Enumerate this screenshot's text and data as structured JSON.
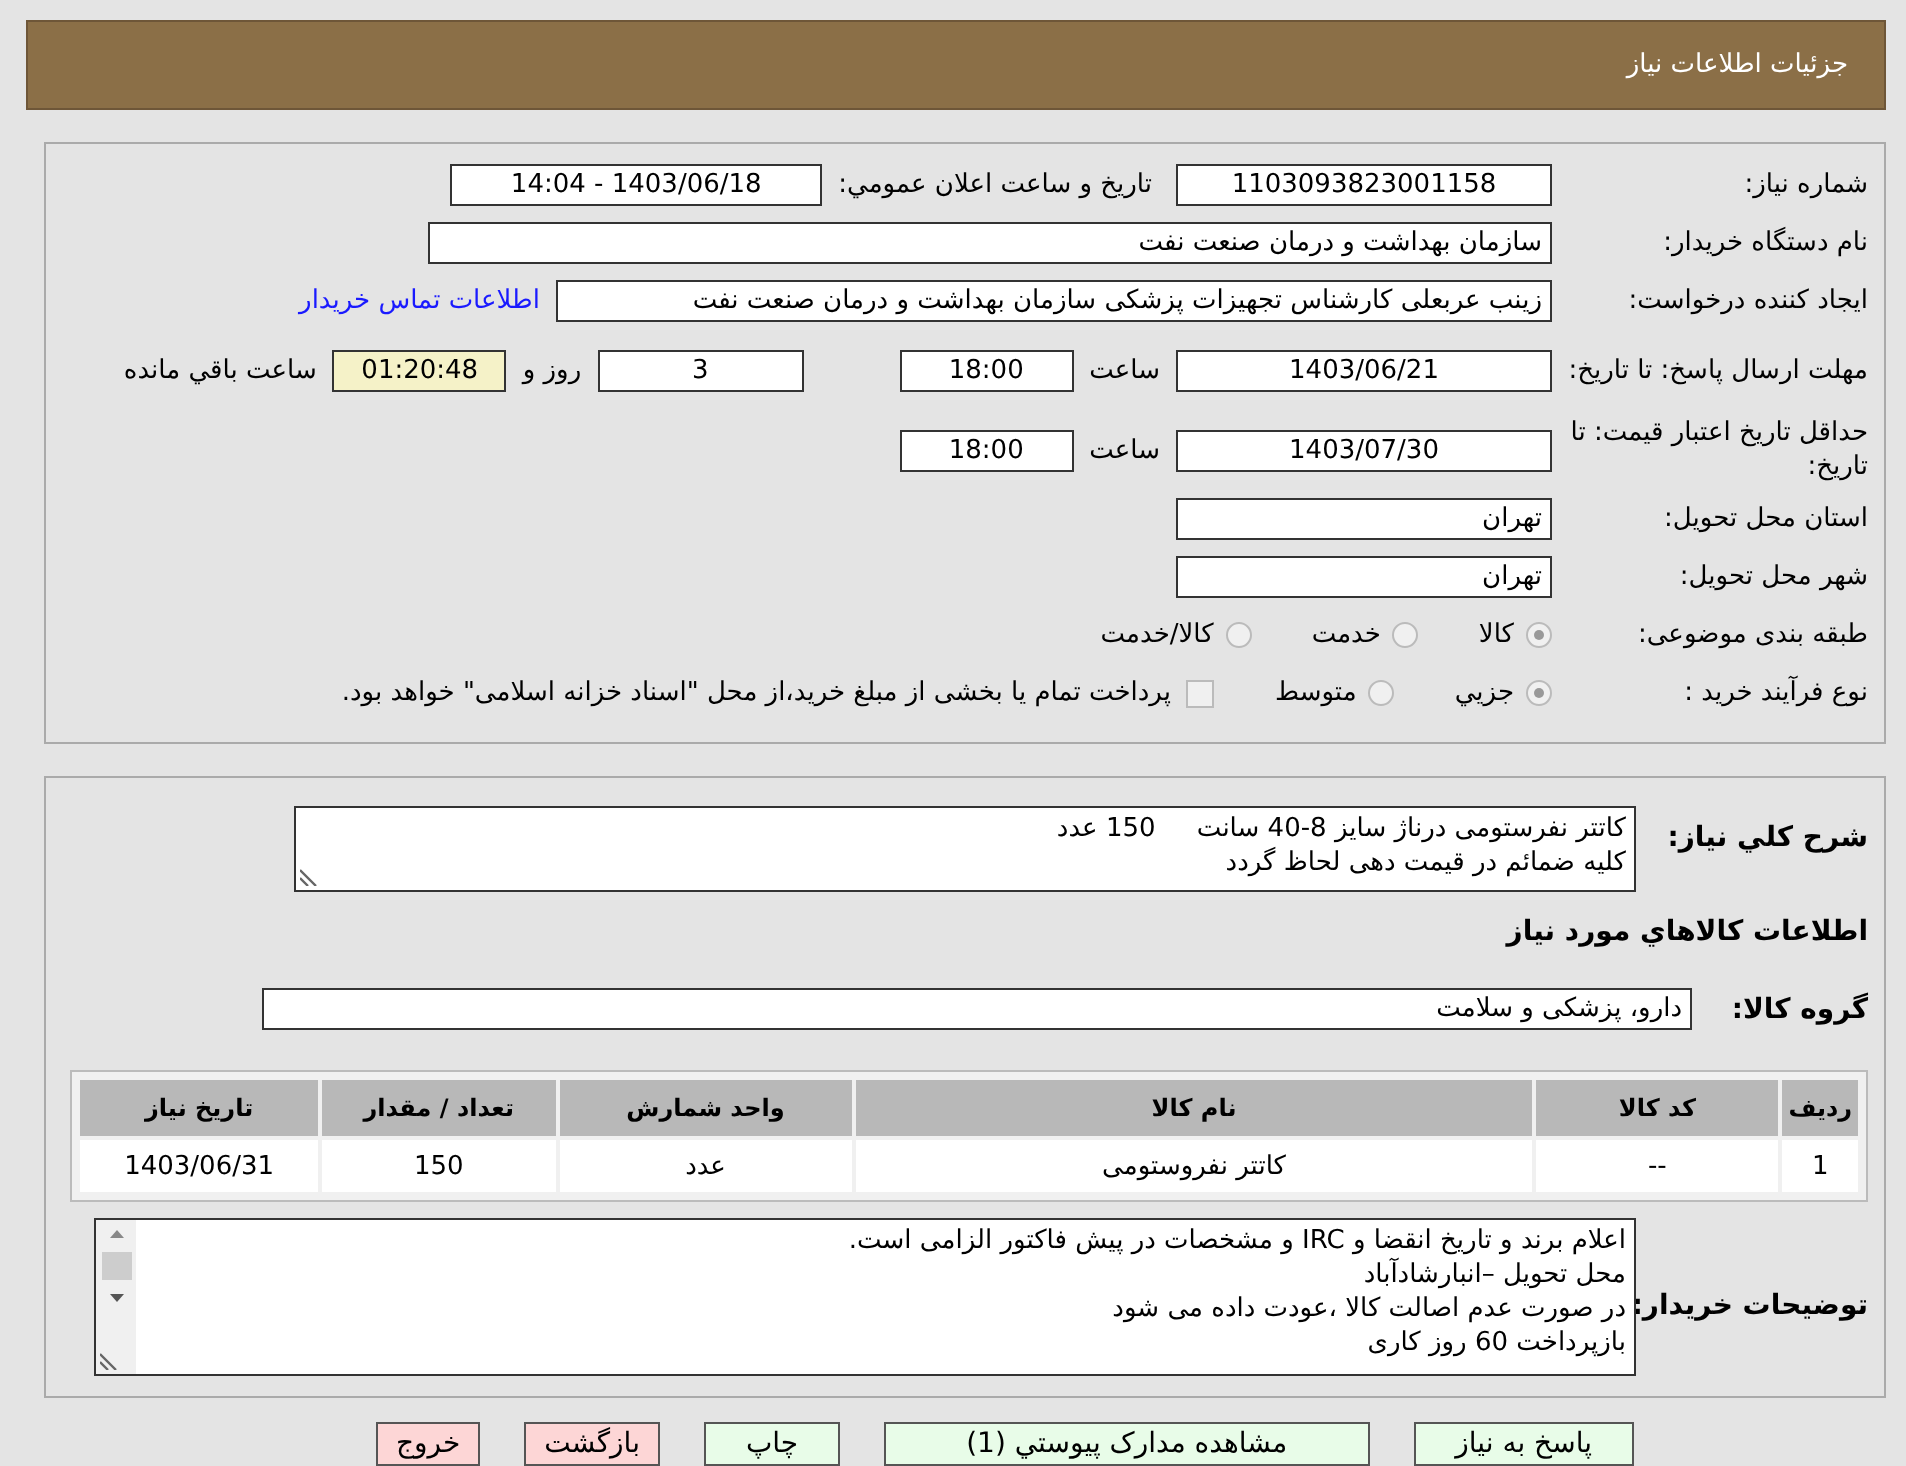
{
  "header": {
    "title": "جزئیات اطلاعات نیاز"
  },
  "details": {
    "need_number": {
      "label": "شماره نیاز:",
      "value": "1103093823001158"
    },
    "announce": {
      "label": "تاریخ و ساعت اعلان عمومي:",
      "value": "1403/06/18 - 14:04"
    },
    "buyer_org": {
      "label": "نام دستگاه خریدار:",
      "value": "سازمان بهداشت و درمان صنعت نفت"
    },
    "requester": {
      "label": "ایجاد کننده درخواست:",
      "value": "زینب عربعلی کارشناس تجهیزات پزشکی سازمان بهداشت و درمان صنعت نفت",
      "link": "اطلاعات تماس خریدار"
    },
    "deadline": {
      "label": "مهلت ارسال پاسخ: تا تاریخ:",
      "date": "1403/06/21",
      "time_label": "ساعت",
      "time": "18:00",
      "days": "3",
      "days_label": "روز و",
      "remaining": "01:20:48",
      "remaining_label": "ساعت باقي مانده"
    },
    "validity": {
      "label": "حداقل تاریخ اعتبار قیمت: تا تاریخ:",
      "date": "1403/07/30",
      "time_label": "ساعت",
      "time": "18:00"
    },
    "province": {
      "label": "استان محل تحویل:",
      "value": "تهران"
    },
    "city": {
      "label": "شهر محل تحویل:",
      "value": "تهران"
    },
    "category": {
      "label": "طبقه بندی موضوعی:",
      "options": [
        {
          "label": "کالا",
          "selected": true
        },
        {
          "label": "خدمت",
          "selected": false
        },
        {
          "label": "کالا/خدمت",
          "selected": false
        }
      ]
    },
    "process": {
      "label": "نوع فرآیند خرید :",
      "options": [
        {
          "label": "جزيي",
          "selected": true
        },
        {
          "label": "متوسط",
          "selected": false
        }
      ],
      "treasury": {
        "checked": false,
        "text": "پرداخت تمام یا بخشی از مبلغ خرید،از محل \"اسناد خزانه اسلامی\" خواهد بود."
      }
    }
  },
  "goods": {
    "summary": {
      "label": "شرح کلي نياز:",
      "lines": [
        "کاتتر نفرستومی درناژ سایز 8-40 سانت     150 عدد",
        "کلیه ضمائم در قیمت دهی لحاظ گردد"
      ]
    },
    "title": "اطلاعات کالاهاي مورد نياز",
    "group": {
      "label": "گروه کالا:",
      "value": "دارو، پزشکی و سلامت"
    },
    "table": {
      "columns": [
        "ردیف",
        "کد کالا",
        "نام کالا",
        "واحد شمارش",
        "تعداد / مقدار",
        "تاریخ نیاز"
      ],
      "rows": [
        [
          "1",
          "--",
          "کاتتر نفروستومی",
          "عدد",
          "150",
          "1403/06/31"
        ]
      ]
    },
    "notes": {
      "label": "توضیحات خریدار:",
      "lines": [
        "اعلام برند و تاریخ انقضا  و IRC  و مشخصات  در پیش فاکتور الزامی است.",
        "محل تحویل –انبارشادآباد",
        "در صورت عدم اصالت کالا ،عودت داده می شود",
        "بازپرداخت 60 روز کاری"
      ]
    }
  },
  "buttons": [
    {
      "label": "پاسخ به نیاز",
      "kind": "normal"
    },
    {
      "label": "مشاهده مدارک پیوستي (1)",
      "kind": "normal"
    },
    {
      "label": "چاپ",
      "kind": "normal"
    },
    {
      "label": "بازگشت",
      "kind": "danger"
    },
    {
      "label": "خروج",
      "kind": "danger"
    }
  ]
}
